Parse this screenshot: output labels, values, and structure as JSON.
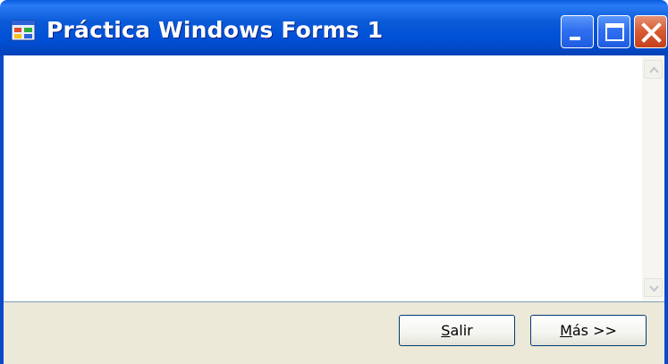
{
  "window": {
    "title": "Práctica Windows Forms 1",
    "title_icon": "form-app-icon",
    "caption_buttons": [
      "minimize-icon",
      "maximize-icon",
      "close-icon"
    ]
  },
  "content": {
    "scrollbar": {
      "up_icon": "chevron-up-icon",
      "down_icon": "chevron-down-icon"
    }
  },
  "buttons": {
    "salir": {
      "mnemonic": "S",
      "rest": "alir"
    },
    "mas": {
      "mnemonic": "M",
      "rest": "ás >>"
    }
  },
  "colors": {
    "titlebar": "#0a5ad8",
    "panel": "#ece9d8",
    "close": "#d85d35",
    "button_border": "#003c74"
  }
}
